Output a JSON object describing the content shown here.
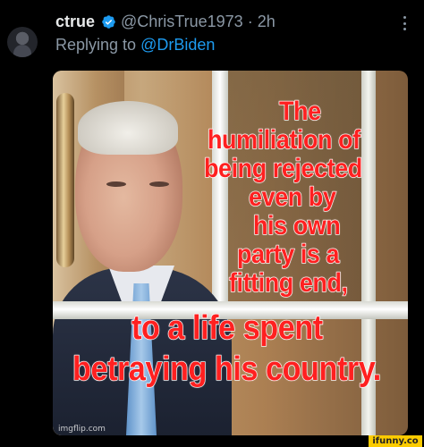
{
  "tweet": {
    "display_name": "ctrue",
    "handle": "@ChrisTrue1973",
    "separator": "·",
    "time": "2h",
    "replying_prefix": "Replying to ",
    "replying_to": "@DrBiden"
  },
  "icons": {
    "verified": "verified-badge-icon",
    "more": "more-options-icon"
  },
  "colors": {
    "background": "#000000",
    "link": "#1d9bf0",
    "muted_text": "#8b98a5",
    "meme_text": "#ff2020",
    "ifunny_yellow": "#fccb00"
  },
  "media": {
    "meme_lines": [
      "The",
      "humiliation of",
      "being rejected",
      "even by",
      "his own",
      "party is a",
      "fitting end,",
      "to a life spent",
      "betraying his country."
    ],
    "imgflip_watermark": "imgflip.com"
  },
  "watermark": {
    "ifunny": "ifunny.co"
  }
}
